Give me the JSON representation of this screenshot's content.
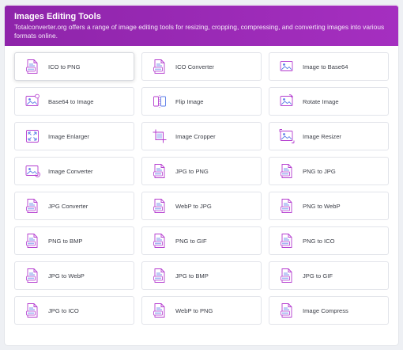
{
  "header": {
    "title": "Images Editing Tools",
    "description": "Totalconverter.org offers a range of image editing tools for resizing, cropping, compressing, and converting images into various formats online."
  },
  "colors": {
    "header_bg": "#9b27b0",
    "icon_accent": "#b43ccf",
    "icon_secondary": "#5b7de8"
  },
  "tools": [
    {
      "label": "ICO to PNG",
      "icon": "ico-to-png-file-icon"
    },
    {
      "label": "ICO Converter",
      "icon": "ico-file-icon"
    },
    {
      "label": "Image to Base64",
      "icon": "image-to-base64-icon"
    },
    {
      "label": "Base64 to Image",
      "icon": "base64-to-image-icon"
    },
    {
      "label": "Flip Image",
      "icon": "flip-image-icon"
    },
    {
      "label": "Rotate Image",
      "icon": "rotate-image-icon"
    },
    {
      "label": "Image Enlarger",
      "icon": "enlarge-arrows-icon"
    },
    {
      "label": "Image Cropper",
      "icon": "crop-image-icon"
    },
    {
      "label": "Image Resizer",
      "icon": "resize-image-icon"
    },
    {
      "label": "Image Converter",
      "icon": "image-converter-icon"
    },
    {
      "label": "JPG to PNG",
      "icon": "jpg-to-png-file-icon"
    },
    {
      "label": "PNG to JPG",
      "icon": "png-to-jpg-file-icon"
    },
    {
      "label": "JPG Converter",
      "icon": "jpg-converter-file-icon"
    },
    {
      "label": "WebP to JPG",
      "icon": "webp-to-jpg-file-icon"
    },
    {
      "label": "PNG to WebP",
      "icon": "png-to-webp-file-icon"
    },
    {
      "label": "PNG to BMP",
      "icon": "png-to-bmp-file-icon"
    },
    {
      "label": "PNG to GIF",
      "icon": "png-to-gif-file-icon"
    },
    {
      "label": "PNG to ICO",
      "icon": "png-to-ico-file-icon"
    },
    {
      "label": "JPG to WebP",
      "icon": "jpg-to-webp-file-icon"
    },
    {
      "label": "JPG to BMP",
      "icon": "jpg-to-bmp-file-icon"
    },
    {
      "label": "JPG to GIF",
      "icon": "jpg-to-gif-file-icon"
    },
    {
      "label": "JPG to ICO",
      "icon": "jpg-to-ico-file-icon"
    },
    {
      "label": "WebP to PNG",
      "icon": "webp-to-png-file-icon"
    },
    {
      "label": "Image Compress",
      "icon": "image-compress-file-icon"
    }
  ]
}
